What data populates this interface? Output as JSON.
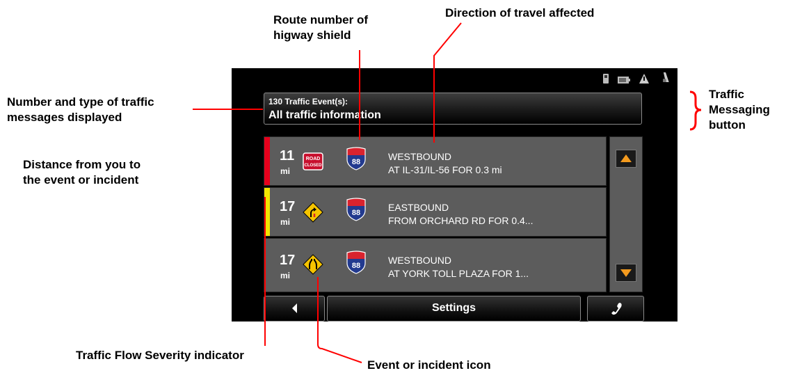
{
  "header": {
    "line1": "130 Traffic Event(s):",
    "line2": "All traffic information"
  },
  "events": [
    {
      "distance": "11",
      "unit": "mi",
      "severity_color": "#e5001c",
      "icon": "road-closed-icon",
      "icon_text_1": "ROAD",
      "icon_text_2": "CLOSED",
      "route": "88",
      "direction": "WESTBOUND",
      "location": "AT IL-31/IL-56 FOR 0.3 mi"
    },
    {
      "distance": "17",
      "unit": "mi",
      "severity_color": "#f2e600",
      "icon": "merge-warning-icon",
      "route": "88",
      "direction": "EASTBOUND",
      "location": "FROM ORCHARD RD FOR 0.4..."
    },
    {
      "distance": "17",
      "unit": "mi",
      "severity_color": "",
      "icon": "lane-narrows-icon",
      "route": "88",
      "direction": "WESTBOUND",
      "location": "AT YORK TOLL PLAZA FOR 1..."
    }
  ],
  "buttons": {
    "settings": "Settings",
    "back_icon": "back-arrow-icon",
    "phone_icon": "phone-icon",
    "scroll_up_icon": "scroll-up-icon",
    "scroll_down_icon": "scroll-down-icon"
  },
  "status_icons": [
    "phone-signal-icon",
    "battery-icon",
    "traffic-alert-icon",
    "gps-icon"
  ],
  "callouts": {
    "route_shield": [
      "Route number of",
      "higway shield"
    ],
    "direction": "Direction of travel affected",
    "messages_count": [
      "Number and type of traffic",
      "messages displayed"
    ],
    "distance": [
      "Distance from you to",
      "the event or incident"
    ],
    "traffic_button": [
      "Traffic",
      "Messaging",
      "button"
    ],
    "severity": "Traffic Flow Severity indicator",
    "event_icon": "Event or incident icon"
  },
  "colors": {
    "callout_line": "#ff0000",
    "screen_bg": "#000000",
    "row_bg": "#5c5c5c",
    "scroll_arrow": "#f39a1e",
    "shield_blue": "#223a8f",
    "shield_red": "#d9232e"
  }
}
